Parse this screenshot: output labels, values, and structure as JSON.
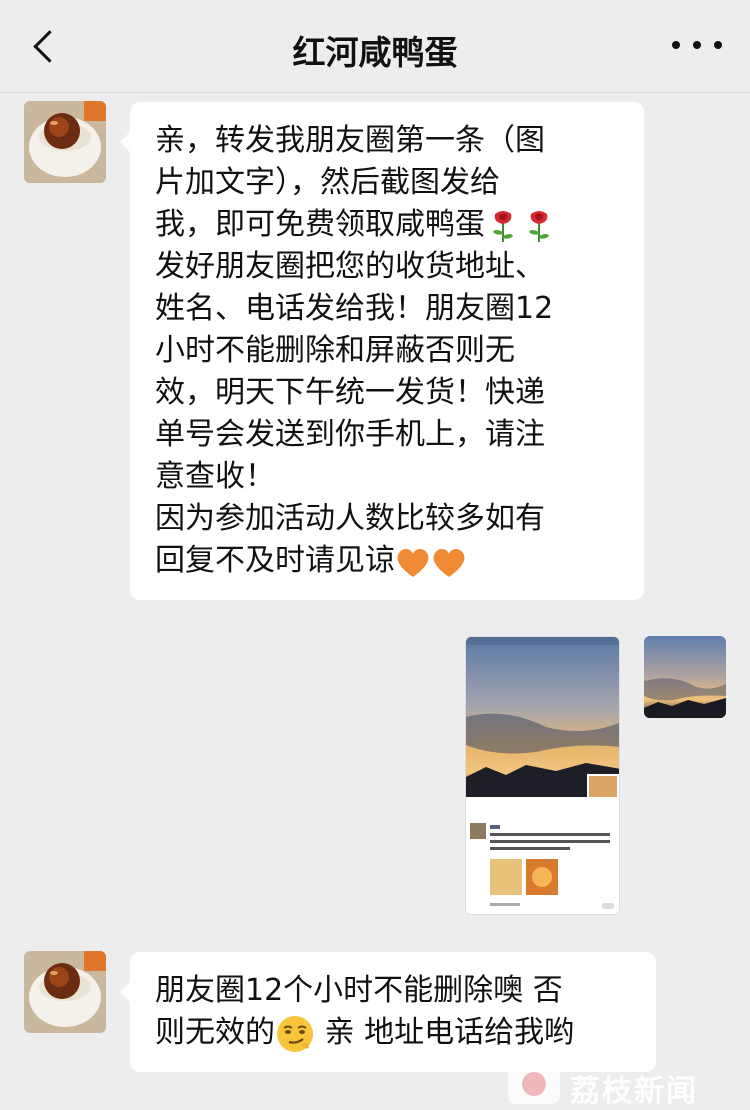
{
  "header": {
    "title": "红河咸鸭蛋",
    "back_icon": "chevron-left-icon",
    "more_icon": "more-dots-icon"
  },
  "messages": [
    {
      "sender": "contact",
      "avatar": "salted-egg-avatar",
      "lines": [
        "亲，转发我朋友圈第一条（图",
        "片加文字），然后截图发给",
        "我，即可免费领取咸鸭蛋",
        "发好朋友圈把您的收货地址、",
        "姓名、电话发给我！朋友圈12",
        "小时不能删除和屏蔽否则无",
        "效，明天下午统一发货！快递",
        "单号会发送到你手机上，请注",
        "意查收！",
        "因为参加活动人数比较多如有",
        "回复不及时请见谅"
      ],
      "emojis": [
        "rose-emoji",
        "rose-emoji",
        "orange-heart-emoji",
        "orange-heart-emoji"
      ]
    },
    {
      "sender": "self",
      "type": "image",
      "content": "moments-screenshot"
    },
    {
      "sender": "contact",
      "avatar": "salted-egg-avatar",
      "lines": [
        "朋友圈12个小时不能删除噢  否",
        "则无效的",
        " 亲  地址电话给我哟"
      ],
      "emojis": [
        "smirk-emoji"
      ]
    }
  ],
  "watermark": {
    "text": "荔枝新闻"
  },
  "colors": {
    "background": "#ededed",
    "bubble": "#ffffff",
    "text": "#111111"
  }
}
